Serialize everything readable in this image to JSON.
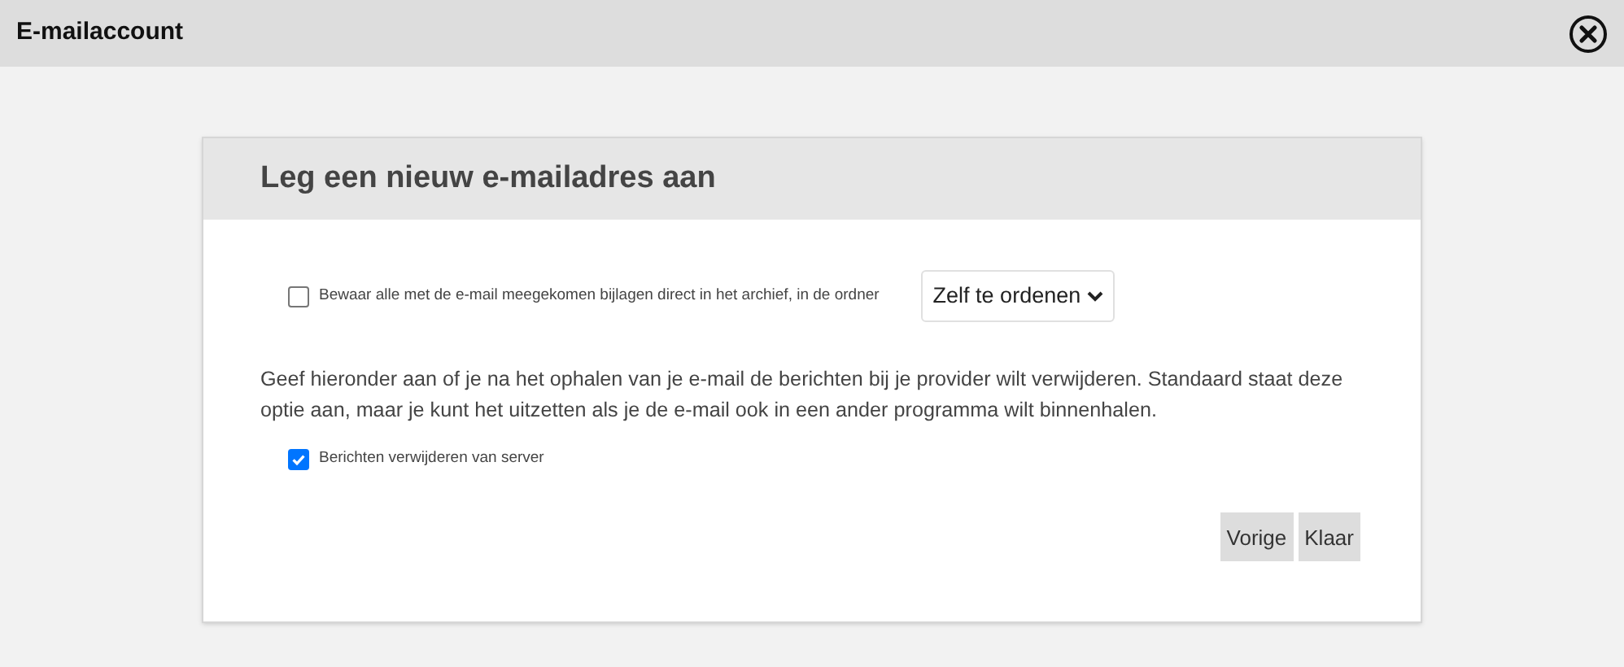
{
  "window": {
    "title": "E-mailaccount"
  },
  "dialog": {
    "title": "Leg een nieuw e-mailadres aan",
    "archive_option": {
      "label": "Bewaar alle met de e-mail meegekomen bijlagen direct in het archief, in de ordner",
      "checked": false,
      "folder": "Zelf te ordenen"
    },
    "description": "Geef hieronder aan of je na het ophalen van je e-mail de berichten bij je provider wilt verwijderen. Standaard staat deze optie aan, maar je kunt het uitzetten als je de e-mail ook in een ander programma wilt binnenhalen.",
    "delete_option": {
      "label": "Berichten verwijderen van server",
      "checked": true
    },
    "buttons": [
      "Vorige",
      "Klaar"
    ]
  }
}
